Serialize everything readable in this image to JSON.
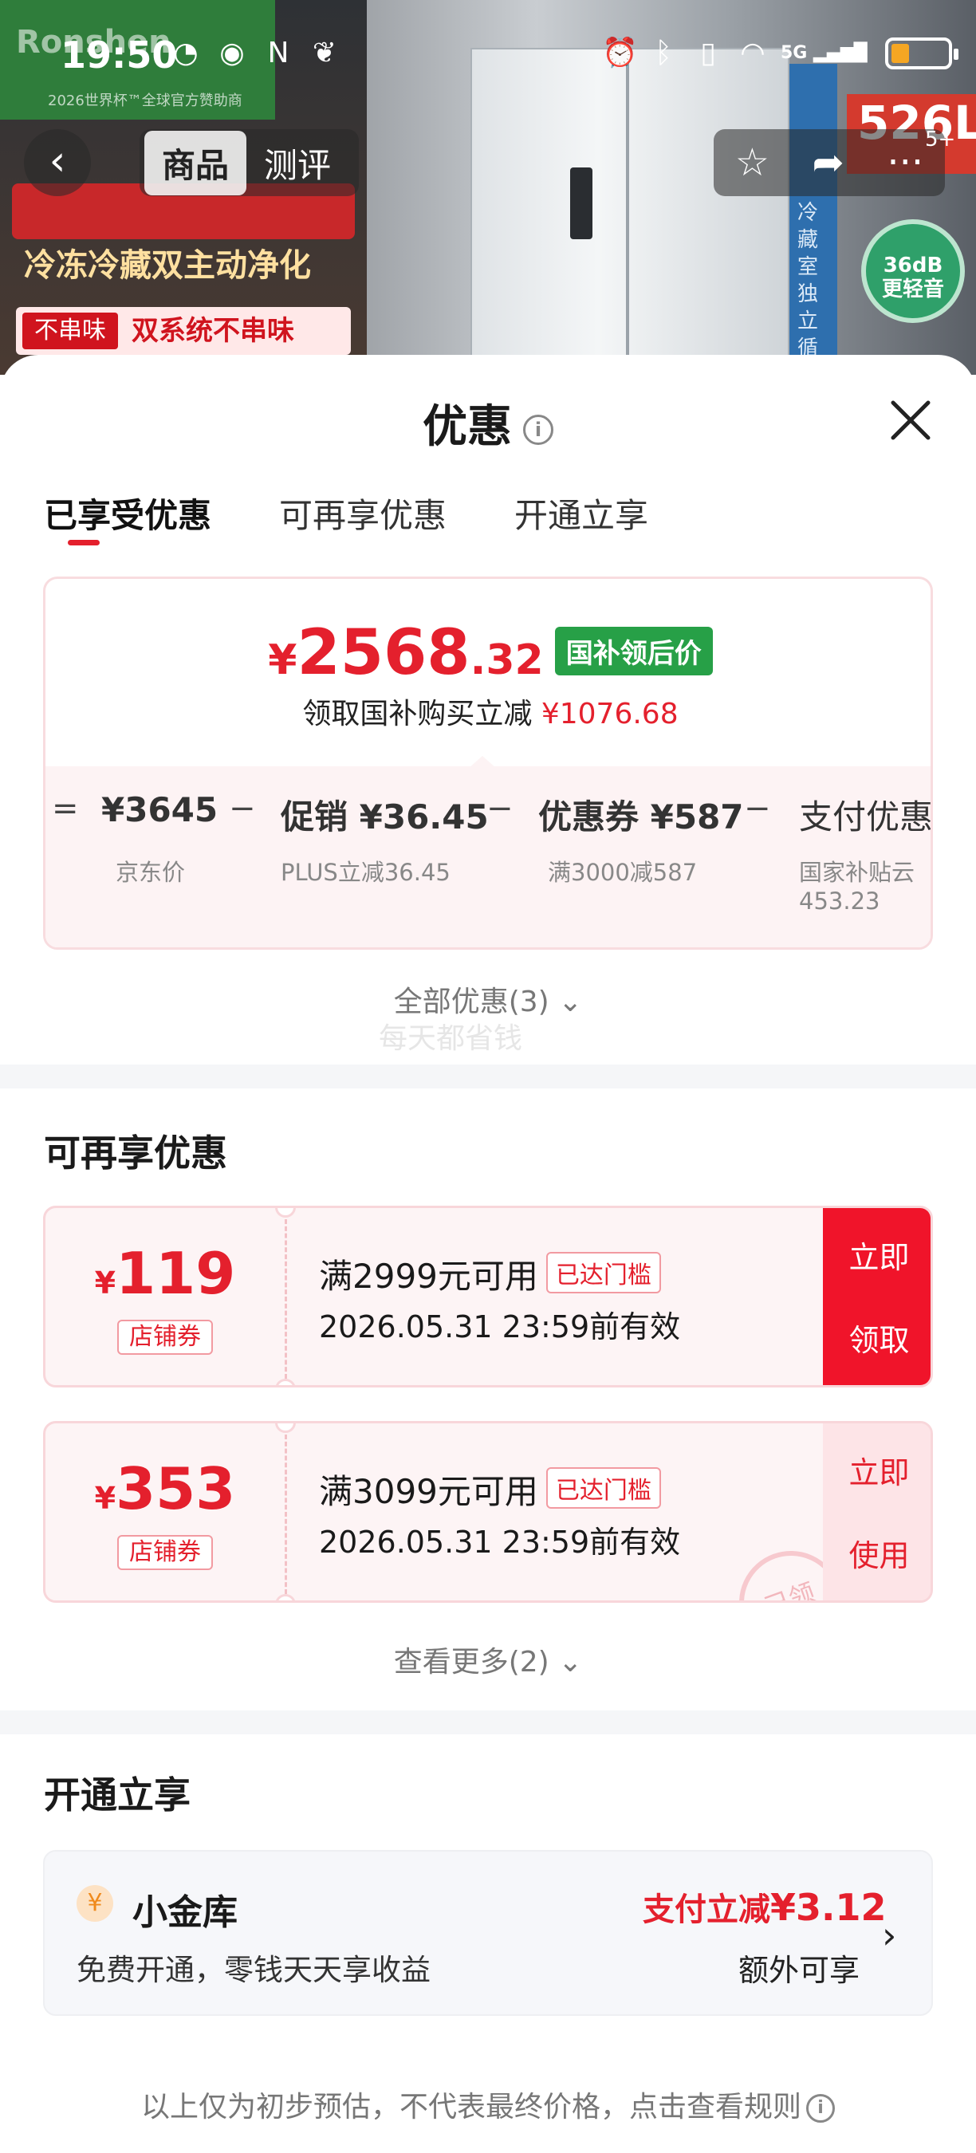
{
  "status_bar": {
    "time": "19:50",
    "left_icons": [
      "app-icon",
      "eye-icon",
      "nfc-icon",
      "wechat-icon"
    ],
    "right_icons": [
      "alarm-icon",
      "bluetooth-icon",
      "vibrate-icon",
      "wifi-icon",
      "5g-signal-icon",
      "battery-icon"
    ],
    "network": "5G",
    "battery_color": "#f5a623"
  },
  "background": {
    "brand": "Ronshen",
    "brand_sub": "2026世界杯™全球官方赞助商",
    "banner1": "冷冻冷藏双主动净化",
    "banner2_tag": "不串味",
    "banner2_text": "双系统不串味",
    "capacity": "526L",
    "side_text": "冷藏室独立循",
    "noise": "36dB 更轻音"
  },
  "nav": {
    "back_icon": "chevron-left-icon",
    "tabs": [
      {
        "label": "商品",
        "active": true
      },
      {
        "label": "测评",
        "active": false
      }
    ],
    "actions": [
      "star-icon",
      "share-icon",
      "more-icon"
    ],
    "badge": "5+"
  },
  "sheet": {
    "title": "优惠",
    "tabs": [
      {
        "label": "已享受优惠",
        "active": true
      },
      {
        "label": "可再享优惠",
        "active": false
      },
      {
        "label": "开通立享",
        "active": false
      }
    ],
    "price": {
      "yen": "¥",
      "integer": "2568",
      "decimal": ".32",
      "tag": "国补领后价",
      "sub_prefix": "领取国补购买立减",
      "sub_amount": "¥1076.68"
    },
    "breakdown": {
      "eq": "=",
      "minus": "−",
      "items": [
        {
          "value": "¥3645",
          "label": "京东价"
        },
        {
          "value": "促销 ¥36.45",
          "label": "PLUS立减36.45"
        },
        {
          "value": "优惠券 ¥587",
          "label": "满3000减587"
        },
        {
          "value": "支付优惠",
          "label": "国家补贴云",
          "label2": "453.23"
        }
      ]
    },
    "all_offers": "全部优惠(3)",
    "watermark": "每天都省钱",
    "more_offers_title": "可再享优惠",
    "coupons": [
      {
        "yen": "¥",
        "amount": "119",
        "type": "店铺券",
        "condition": "满2999元可用",
        "badge": "已达门槛",
        "validity": "2026.05.31 23:59前有效",
        "button_line1": "立即",
        "button_line2": "领取"
      },
      {
        "yen": "¥",
        "amount": "353",
        "type": "店铺券",
        "condition": "满3099元可用",
        "badge": "已达门槛",
        "validity": "2026.05.31 23:59前有效",
        "button_line1": "立即",
        "button_line2": "使用",
        "stamp": "已领"
      }
    ],
    "see_more": "查看更多(2)",
    "open_title": "开通立享",
    "vault": {
      "name": "小金库",
      "desc": "免费开通，零钱天天享收益",
      "save_prefix": "支付立减",
      "save_amount": "¥3.12",
      "extra": "额外可享"
    },
    "disclaimer": "以上仅为初步预估，不代表最终价格，点击查看规则"
  },
  "colors": {
    "accent_red": "#e4202d",
    "claim_button": "#f0142a",
    "tag_green": "#27a047"
  }
}
